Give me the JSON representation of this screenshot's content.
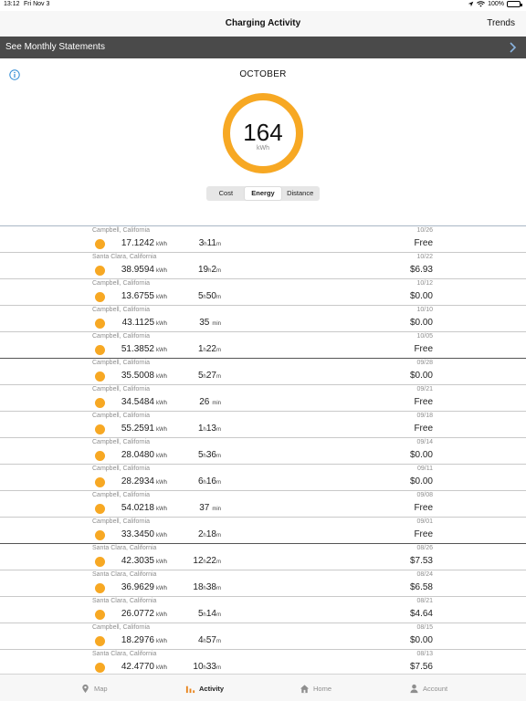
{
  "status_bar": {
    "time": "13:12",
    "date": "Fri Nov 3",
    "battery": "100%"
  },
  "nav": {
    "title": "Charging Activity",
    "trends_label": "Trends"
  },
  "banner": {
    "label": "See Monthly Statements"
  },
  "summary": {
    "month": "OCTOBER",
    "value": "164",
    "unit": "kWh",
    "ring_fill_fraction": 1.0,
    "ring_color": "#f7a823",
    "segments": [
      {
        "label": "Cost",
        "active": false
      },
      {
        "label": "Energy",
        "active": true
      },
      {
        "label": "Distance",
        "active": false
      }
    ]
  },
  "sessions": [
    {
      "location": "Campbell, California",
      "date": "10/26",
      "energy": "17.1242",
      "energy_unit": "kWh",
      "dur_h": "3",
      "dur_m": "11",
      "cost": "Free"
    },
    {
      "location": "Santa Clara, California",
      "date": "10/22",
      "energy": "38.9594",
      "energy_unit": "kWh",
      "dur_h": "19",
      "dur_m": "2",
      "cost": "$6.93"
    },
    {
      "location": "Campbell, California",
      "date": "10/12",
      "energy": "13.6755",
      "energy_unit": "kWh",
      "dur_h": "5",
      "dur_m": "50",
      "cost": "$0.00"
    },
    {
      "location": "Campbell, California",
      "date": "10/10",
      "energy": "43.1125",
      "energy_unit": "kWh",
      "dur_h": "",
      "dur_m": "35",
      "cost": "$0.00"
    },
    {
      "location": "Campbell, California",
      "date": "10/05",
      "energy": "51.3852",
      "energy_unit": "kWh",
      "dur_h": "1",
      "dur_m": "22",
      "cost": "Free"
    },
    {
      "location": "Campbell, California",
      "date": "09/28",
      "energy": "35.5008",
      "energy_unit": "kWh",
      "dur_h": "5",
      "dur_m": "27",
      "cost": "$0.00"
    },
    {
      "location": "Campbell, California",
      "date": "09/21",
      "energy": "34.5484",
      "energy_unit": "kWh",
      "dur_h": "",
      "dur_m": "26",
      "cost": "Free"
    },
    {
      "location": "Campbell, California",
      "date": "09/18",
      "energy": "55.2591",
      "energy_unit": "kWh",
      "dur_h": "1",
      "dur_m": "13",
      "cost": "Free"
    },
    {
      "location": "Campbell, California",
      "date": "09/14",
      "energy": "28.0480",
      "energy_unit": "kWh",
      "dur_h": "5",
      "dur_m": "36",
      "cost": "$0.00"
    },
    {
      "location": "Campbell, California",
      "date": "09/11",
      "energy": "28.2934",
      "energy_unit": "kWh",
      "dur_h": "6",
      "dur_m": "16",
      "cost": "$0.00"
    },
    {
      "location": "Campbell, California",
      "date": "09/08",
      "energy": "54.0218",
      "energy_unit": "kWh",
      "dur_h": "",
      "dur_m": "37",
      "cost": "Free"
    },
    {
      "location": "Campbell, California",
      "date": "09/01",
      "energy": "33.3450",
      "energy_unit": "kWh",
      "dur_h": "2",
      "dur_m": "18",
      "cost": "Free"
    },
    {
      "location": "Santa Clara, California",
      "date": "08/26",
      "energy": "42.3035",
      "energy_unit": "kWh",
      "dur_h": "12",
      "dur_m": "22",
      "cost": "$7.53"
    },
    {
      "location": "Santa Clara, California",
      "date": "08/24",
      "energy": "36.9629",
      "energy_unit": "kWh",
      "dur_h": "18",
      "dur_m": "38",
      "cost": "$6.58"
    },
    {
      "location": "Santa Clara, California",
      "date": "08/21",
      "energy": "26.0772",
      "energy_unit": "kWh",
      "dur_h": "5",
      "dur_m": "14",
      "cost": "$4.64"
    },
    {
      "location": "Campbell, California",
      "date": "08/15",
      "energy": "18.2976",
      "energy_unit": "kWh",
      "dur_h": "4",
      "dur_m": "57",
      "cost": "$0.00"
    },
    {
      "location": "Santa Clara, California",
      "date": "08/13",
      "energy": "42.4770",
      "energy_unit": "kWh",
      "dur_h": "10",
      "dur_m": "33",
      "cost": "$7.56"
    }
  ],
  "units": {
    "hours": "h",
    "minutes": "m",
    "minutes_only": "min"
  },
  "tabs": [
    {
      "label": "Map",
      "icon": "map-pin-icon",
      "active": false
    },
    {
      "label": "Activity",
      "icon": "bar-chart-icon",
      "active": true
    },
    {
      "label": "Home",
      "icon": "home-icon",
      "active": false
    },
    {
      "label": "Account",
      "icon": "person-icon",
      "active": false
    }
  ],
  "colors": {
    "accent": "#f7a823",
    "activity_tab": "#e8831a",
    "banner": "#4a4a4a",
    "info_blue": "#2f8bd4"
  }
}
